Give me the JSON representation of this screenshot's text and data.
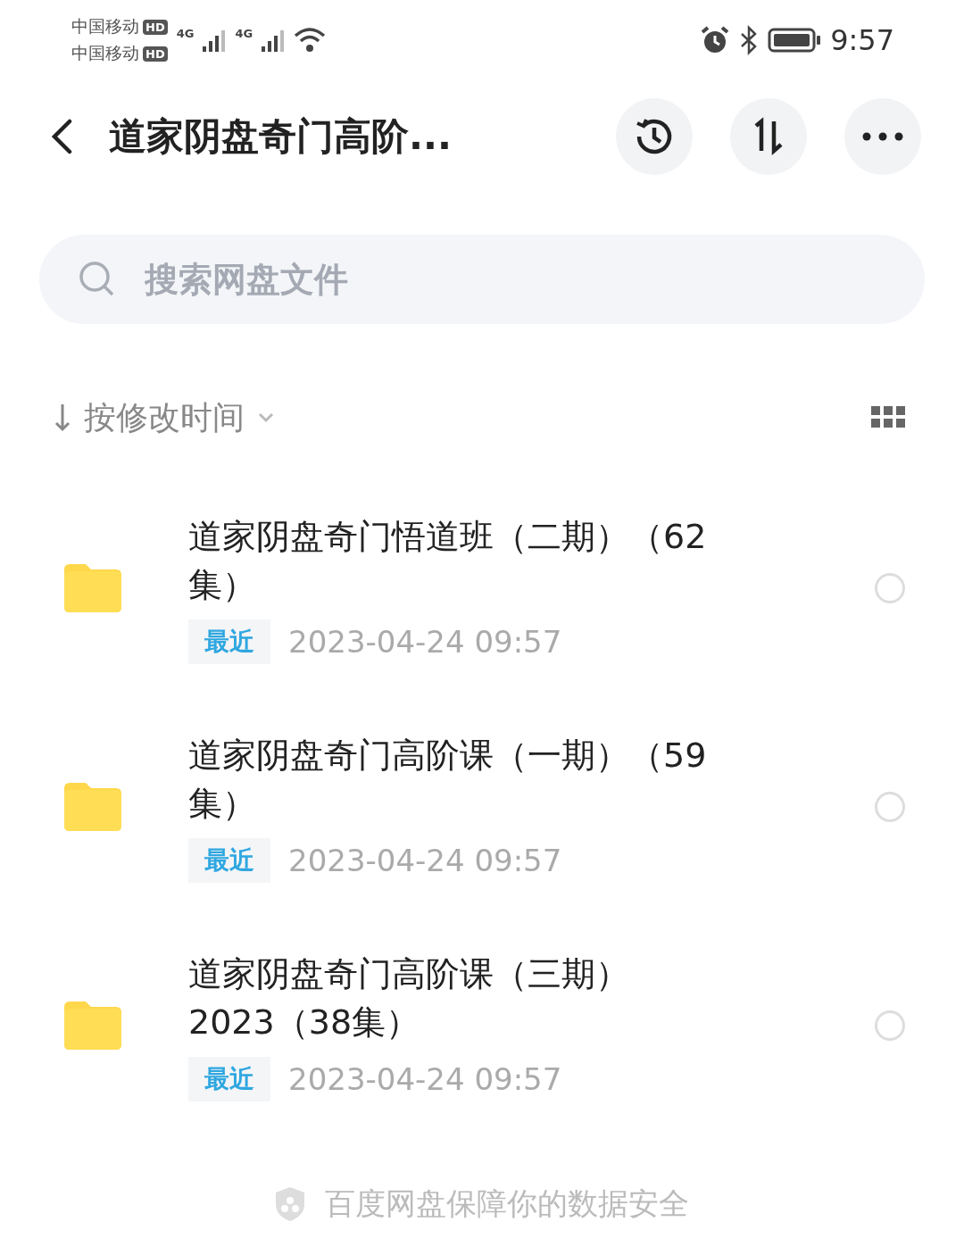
{
  "status_bar": {
    "carriers": [
      {
        "name": "中国移动",
        "badge": "HD",
        "network": "4G"
      },
      {
        "name": "中国移动",
        "badge": "HD",
        "network": "4G"
      }
    ],
    "time": "9:57"
  },
  "header": {
    "title": "道家阴盘奇门高阶..."
  },
  "search": {
    "placeholder": "搜索网盘文件"
  },
  "sort": {
    "label": "按修改时间"
  },
  "files": [
    {
      "name_lines": [
        "道家阴盘奇门悟道班（二期）（62",
        "集）"
      ],
      "tag": "最近",
      "date": "2023-04-24  09:57",
      "selected": false
    },
    {
      "name_lines": [
        "道家阴盘奇门高阶课（一期）（59",
        "集）"
      ],
      "tag": "最近",
      "date": "2023-04-24  09:57",
      "selected": false
    },
    {
      "name_lines": [
        "道家阴盘奇门高阶课（三期）",
        "2023（38集）"
      ],
      "tag": "最近",
      "date": "2023-04-24  09:57",
      "selected": false
    }
  ],
  "footer": {
    "text": "百度网盘保障你的数据安全"
  }
}
